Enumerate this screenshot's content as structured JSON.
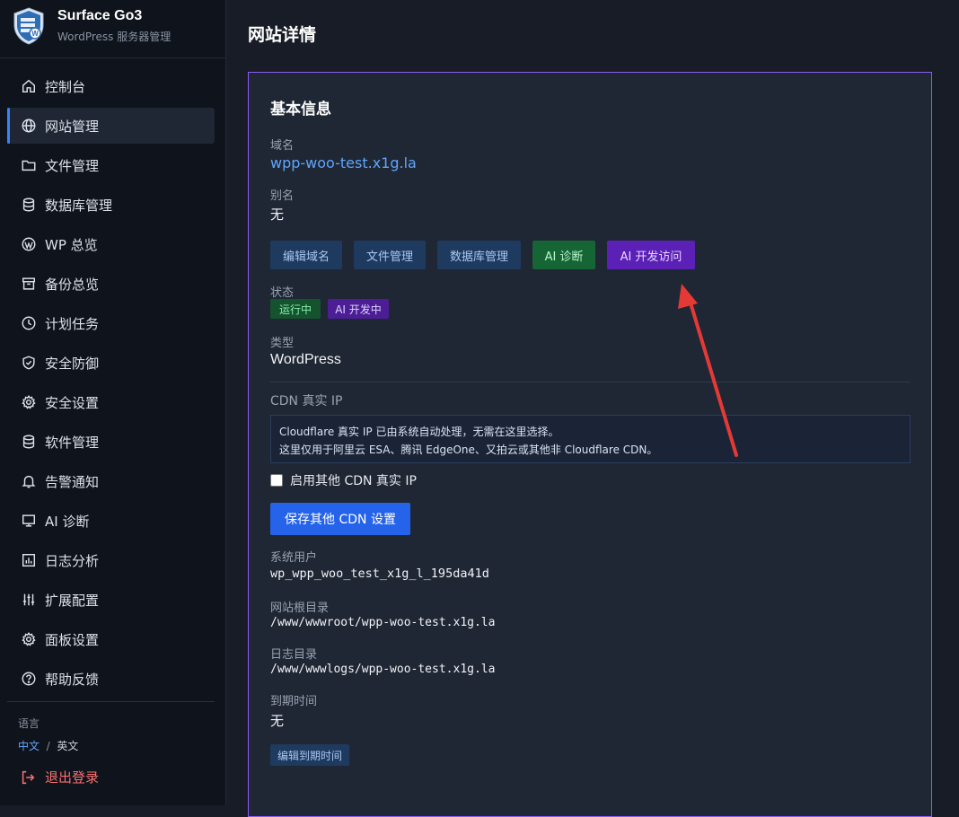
{
  "brand": {
    "title": "Surface Go3",
    "subtitle": "WordPress 服务器管理",
    "logo_icon": "server-shield-icon"
  },
  "sidebar": {
    "items": [
      {
        "label": "控制台",
        "icon": "home-icon",
        "active": false
      },
      {
        "label": "网站管理",
        "icon": "globe-icon",
        "active": true
      },
      {
        "label": "文件管理",
        "icon": "folder-icon",
        "active": false
      },
      {
        "label": "数据库管理",
        "icon": "database-icon",
        "active": false
      },
      {
        "label": "WP 总览",
        "icon": "wordpress-icon",
        "active": false
      },
      {
        "label": "备份总览",
        "icon": "archive-icon",
        "active": false
      },
      {
        "label": "计划任务",
        "icon": "clock-icon",
        "active": false
      },
      {
        "label": "安全防御",
        "icon": "shield-icon",
        "active": false
      },
      {
        "label": "安全设置",
        "icon": "gear-icon",
        "active": false
      },
      {
        "label": "软件管理",
        "icon": "database-icon",
        "active": false
      },
      {
        "label": "告警通知",
        "icon": "bell-icon",
        "active": false
      },
      {
        "label": "AI 诊断",
        "icon": "monitor-icon",
        "active": false
      },
      {
        "label": "日志分析",
        "icon": "chart-icon",
        "active": false
      },
      {
        "label": "扩展配置",
        "icon": "sliders-icon",
        "active": false
      },
      {
        "label": "面板设置",
        "icon": "gear-icon",
        "active": false
      },
      {
        "label": "帮助反馈",
        "icon": "help-icon",
        "active": false
      }
    ],
    "language_label": "语言",
    "language_cn": "中文",
    "language_sep": "/",
    "language_en": "英文",
    "logout": "退出登录"
  },
  "page": {
    "title": "网站详情",
    "section_title": "基本信息",
    "domain_label": "域名",
    "domain_value": "wpp-woo-test.x1g.la",
    "alias_label": "别名",
    "alias_value": "无",
    "buttons": {
      "edit_domain": "编辑域名",
      "file_manage": "文件管理",
      "db_manage": "数据库管理",
      "ai_diagnose": "AI 诊断",
      "ai_dev_access": "AI 开发访问"
    },
    "status_label": "状态",
    "status_running": "运行中",
    "status_ai_dev": "AI 开发中",
    "type_label": "类型",
    "type_value": "WordPress",
    "cdn_label": "CDN 真实 IP",
    "cdn_info_line1": "Cloudflare 真实 IP 已由系统自动处理，无需在这里选择。",
    "cdn_info_line2": "这里仅用于阿里云 ESA、腾讯 EdgeOne、又拍云或其他非 Cloudflare CDN。",
    "cdn_checkbox_label": "启用其他 CDN 真实 IP",
    "cdn_checkbox_checked": false,
    "cdn_save_button": "保存其他 CDN 设置",
    "sys_user_label": "系统用户",
    "sys_user_value": "wp_wpp_woo_test_x1g_l_195da41d",
    "root_dir_label": "网站根目录",
    "root_dir_value": "/www/wwwroot/wpp-woo-test.x1g.la",
    "log_dir_label": "日志目录",
    "log_dir_value": "/www/wwwlogs/wpp-woo-test.x1g.la",
    "expire_label": "到期时间",
    "expire_value": "无",
    "edit_expire_button": "编辑到期时间"
  },
  "colors": {
    "accent": "#3b82f6",
    "card_border": "#8b5cf6",
    "annotation_arrow": "#e53935"
  }
}
